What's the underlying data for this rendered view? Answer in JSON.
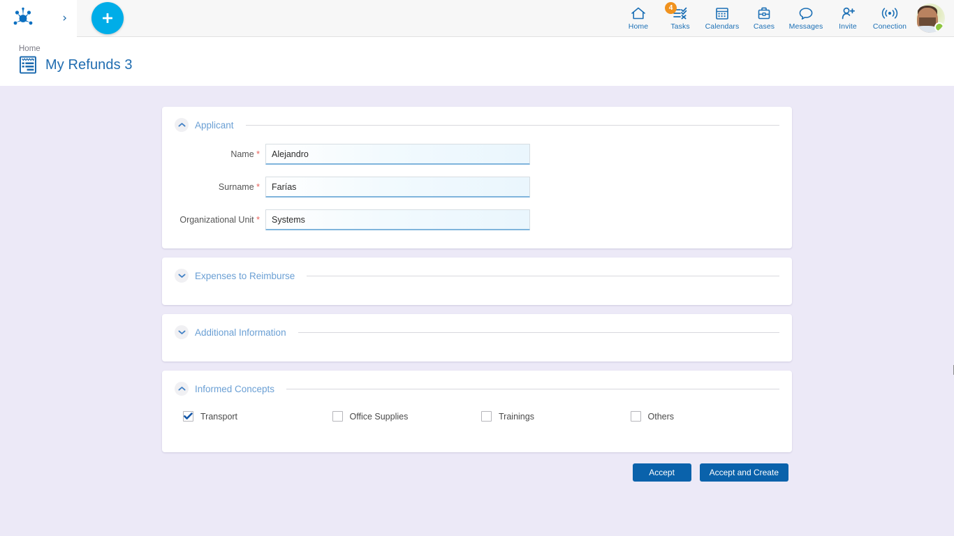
{
  "topbar": {
    "logo_name": "frog-network-logo",
    "expand_label": "›",
    "add_button_label": "+",
    "nav_items": [
      {
        "label": "Home",
        "icon": "home-icon",
        "badge": null
      },
      {
        "label": "Tasks",
        "icon": "tasks-icon",
        "badge": "4"
      },
      {
        "label": "Calendars",
        "icon": "calendar-icon",
        "badge": null
      },
      {
        "label": "Cases",
        "icon": "briefcase-icon",
        "badge": null
      },
      {
        "label": "Messages",
        "icon": "message-icon",
        "badge": null
      },
      {
        "label": "Invite",
        "icon": "invite-icon",
        "badge": null
      },
      {
        "label": "Conection",
        "icon": "signal-icon",
        "badge": null
      }
    ],
    "avatar_name": "user-avatar",
    "status": "online"
  },
  "page_header": {
    "breadcrumb": "Home",
    "title": "My Refunds 3",
    "title_icon": "form-document-icon",
    "help_label": "?"
  },
  "sections": [
    {
      "id": "applicant",
      "title": "Applicant",
      "expanded": true,
      "chevron": "chevron-up-icon",
      "fields": [
        {
          "label": "Name",
          "required": true,
          "value": "Alejandro",
          "placeholder": ""
        },
        {
          "label": "Surname",
          "required": true,
          "value": "Farías",
          "placeholder": ""
        },
        {
          "label": "Organizational Unit",
          "required": true,
          "value": "Systems",
          "placeholder": ""
        }
      ]
    },
    {
      "id": "expenses",
      "title": "Expenses to Reimburse",
      "expanded": false,
      "chevron": "chevron-down-icon"
    },
    {
      "id": "additional",
      "title": "Additional Information",
      "expanded": false,
      "chevron": "chevron-down-icon"
    },
    {
      "id": "concepts",
      "title": "Informed Concepts",
      "expanded": true,
      "chevron": "chevron-up-icon",
      "checkboxes": [
        {
          "label": "Transport",
          "checked": true
        },
        {
          "label": "Office Supplies",
          "checked": false
        },
        {
          "label": "Trainings",
          "checked": false
        },
        {
          "label": "Others",
          "checked": false
        }
      ]
    }
  ],
  "actions": {
    "accept_label": "Accept",
    "accept_create_label": "Accept and Create"
  },
  "colors": {
    "accent_blue": "#0a62ab",
    "cyan": "#00ADE8",
    "nav_blue": "#1b6fb5",
    "section_title": "#6a9fd4",
    "badge_orange": "#f0921e",
    "required_red": "#e8615a",
    "page_background": "#ece9f7",
    "status_green": "#8dc63f"
  }
}
